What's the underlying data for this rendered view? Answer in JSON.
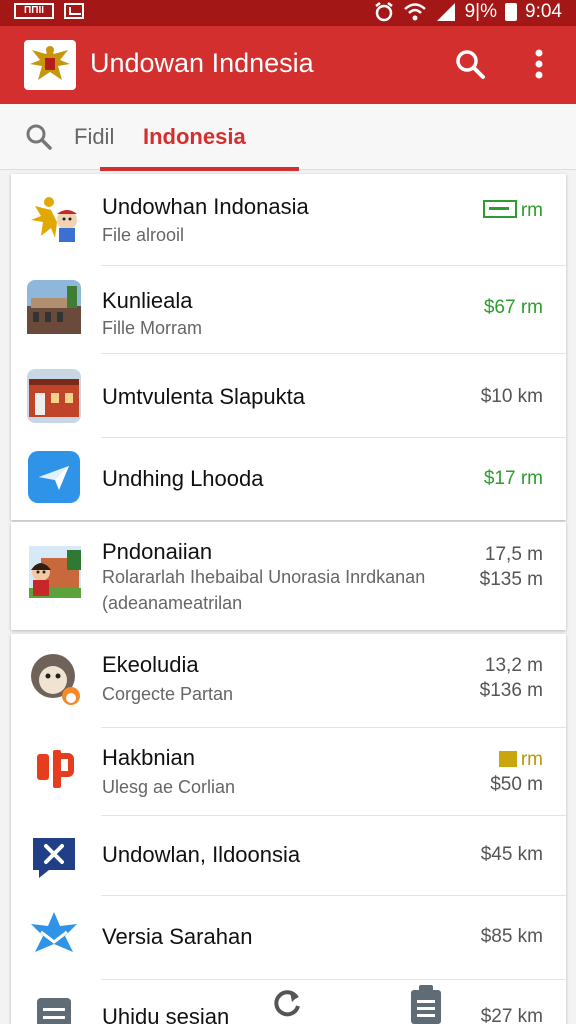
{
  "status_bar": {
    "left_badge": "ΠΠΙΙ",
    "battery_percent": "9|%",
    "time": "9:04"
  },
  "app_bar": {
    "title": "Undowan Indnesia",
    "color": "#d32f2f"
  },
  "tabs": {
    "find_label": "Fidil",
    "active_label": "Indonesia"
  },
  "list_group_1": [
    {
      "title": "Undowhan Indonasia",
      "subtitle": "File alrooil",
      "value": "rm",
      "value_color": "#2e9c2e",
      "icon": "garuda-emblem-icon"
    },
    {
      "title": "Kunlieala",
      "subtitle": "Fille Morram",
      "value": "$67 rm",
      "value_color": "#2e9c2e",
      "icon": "building-photo-icon"
    },
    {
      "title": "Umtvulenta Slapukta",
      "subtitle": "",
      "value": "$10 km",
      "value_color": "#555555",
      "icon": "storefront-photo-icon"
    },
    {
      "title": "Undhing Lhooda",
      "subtitle": "",
      "value": "$17 rm",
      "value_color": "#2e9c2e",
      "icon": "paper-plane-icon"
    }
  ],
  "list_group_2": [
    {
      "title": "Pndonaiian",
      "subtitle": "Rolararlah Ihebaibal Unorasia Inrdkanan",
      "subtitle2": "(adeanameatrilan",
      "value": "17,5 m",
      "value2": "$135 m",
      "icon": "cartoon-house-icon"
    }
  ],
  "list_group_3": [
    {
      "title": "Ekeoludia",
      "subtitle": "Corgecte Partan",
      "value": "13,2 m",
      "value2": "$136 m",
      "icon": "monkey-mascot-icon"
    },
    {
      "title": "Hakbnian",
      "subtitle": "Ulesg ae Corlian",
      "value": "rm",
      "value2": "$50 m",
      "icon": "red-logo-icon"
    },
    {
      "title": "Undowlan, Ildoonsia",
      "subtitle": "",
      "value": "$45 km",
      "icon": "chat-x-icon"
    },
    {
      "title": "Versia Sarahan",
      "subtitle": "",
      "value": "$85 km",
      "icon": "star-mail-icon"
    },
    {
      "title": "Uhidu sesian",
      "subtitle": "",
      "value": "$27 km",
      "icon": "document-icon"
    }
  ]
}
